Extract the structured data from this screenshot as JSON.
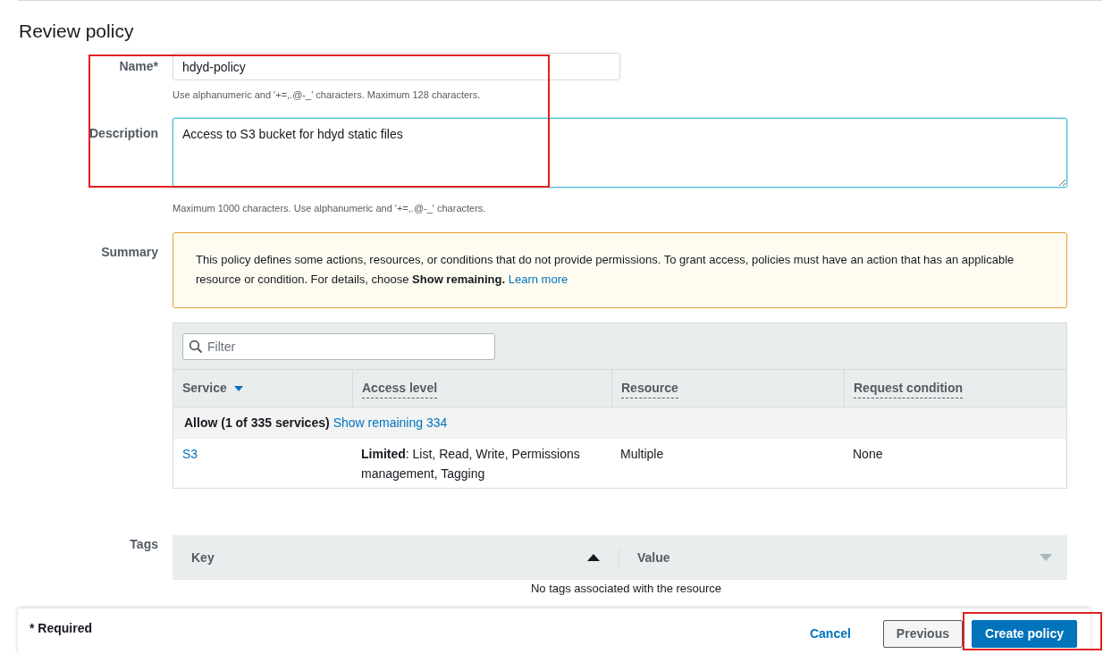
{
  "title": "Review policy",
  "name_field": {
    "label": "Name*",
    "value": "hdyd-policy",
    "hint": "Use alphanumeric and '+=,.@-_' characters. Maximum 128 characters."
  },
  "description_field": {
    "label": "Description",
    "value": "Access to S3 bucket for hdyd static files",
    "hint": "Maximum 1000 characters. Use alphanumeric and '+=,.@-_' characters.",
    "focused": true
  },
  "summary": {
    "label": "Summary",
    "alert": "This policy defines some actions, resources, or conditions that do not provide permissions. To grant access, policies must have an action that has an applicable resource or condition. For details, choose **Show remaining.**",
    "alert_link": "Learn more",
    "filter": {
      "placeholder": "Filter"
    },
    "columns": [
      {
        "label": "Service",
        "sorted": true
      },
      {
        "label": "Access level",
        "sorted": false
      },
      {
        "label": "Resource",
        "sorted": false
      },
      {
        "label": "Request condition",
        "sorted": false
      }
    ],
    "group": {
      "label": "Allow (1 of 335 services)",
      "link": "Show remaining 334"
    },
    "rows": [
      {
        "service": "S3",
        "access_level": "**Limited**: List, Read, Write, Permissions management, Tagging",
        "resource": "Multiple",
        "request_condition": "None"
      }
    ]
  },
  "tags": {
    "label": "Tags",
    "columns": [
      "Key",
      "Value"
    ],
    "empty": "No tags associated with the resource"
  },
  "footer": {
    "required": "* Required",
    "buttons": [
      {
        "label": "Cancel",
        "kind": "link"
      },
      {
        "label": "Previous",
        "kind": "secondary"
      },
      {
        "label": "Create policy",
        "kind": "primary"
      }
    ]
  },
  "highlights": {
    "fields": true,
    "create_button": true
  }
}
